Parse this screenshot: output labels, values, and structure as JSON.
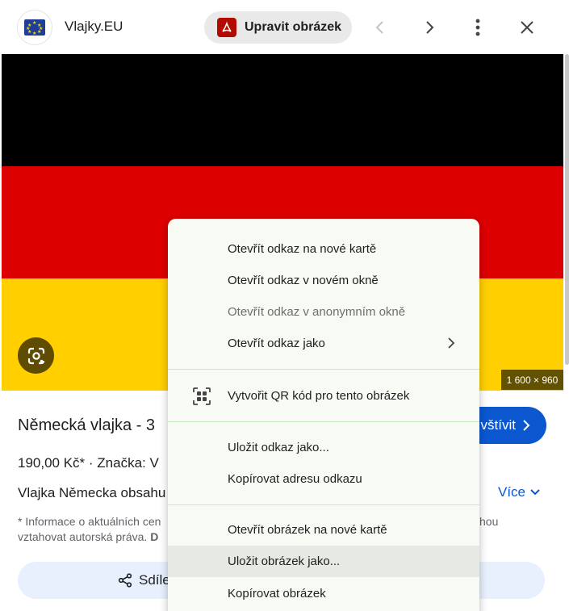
{
  "header": {
    "site_name": "Vlajky.EU",
    "edit_button": "Upravit obrázek",
    "icons": [
      "eu-flag-favicon",
      "pdf-icon",
      "chevron-left-icon",
      "chevron-right-icon",
      "more-vert-icon",
      "close-icon"
    ]
  },
  "image": {
    "dimensions": "1 600 × 960",
    "stripe_colors": [
      "#000000",
      "#dd0000",
      "#ffcf00"
    ],
    "lens_icon": "google-lens-icon"
  },
  "info": {
    "title": "Německá vlajka - 3",
    "visit_button": "vštívit",
    "price_line": "190,00 Kč*  ·  Značka: V",
    "description": "Vlajka Německa obsahu",
    "more_link": "Více",
    "note_line1": "* Informace o aktuálních cen",
    "note_tail": "hou",
    "note_line2_a": "vztahovat autorská práva. ",
    "note_line2_b": "D",
    "share_button": "Sdíle"
  },
  "context_menu": {
    "items": [
      {
        "label": "Otevřít odkaz na nové kartě"
      },
      {
        "label": "Otevřít odkaz v novém okně"
      },
      {
        "label": "Otevřít odkaz v anonymním okně"
      },
      {
        "label": "Otevřít odkaz jako"
      },
      {
        "label": "Vytvořit QR kód pro tento obrázek"
      },
      {
        "label": "Uložit odkaz jako..."
      },
      {
        "label": "Kopírovat adresu odkazu"
      },
      {
        "label": "Otevřít obrázek na nové kartě"
      },
      {
        "label": "Uložit obrázek jako..."
      },
      {
        "label": "Kopírovat obrázek"
      }
    ]
  },
  "colors": {
    "accent": "#0b57d0",
    "menu_bg": "#f7fbf4",
    "menu_highlight": "#e6eae2"
  }
}
